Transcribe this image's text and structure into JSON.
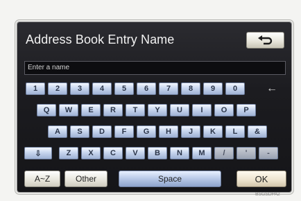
{
  "header": {
    "title": "Address Book Entry Name"
  },
  "input": {
    "value": "Enter a name"
  },
  "keyboard": {
    "row1": [
      "1",
      "2",
      "3",
      "4",
      "5",
      "6",
      "7",
      "8",
      "9",
      "0"
    ],
    "row2": [
      "Q",
      "W",
      "E",
      "R",
      "T",
      "Y",
      "U",
      "I",
      "O",
      "P"
    ],
    "row3": [
      "A",
      "S",
      "D",
      "F",
      "G",
      "H",
      "J",
      "K",
      "L",
      "&"
    ],
    "row4": [
      "Z",
      "X",
      "C",
      "V",
      "B",
      "N",
      "M",
      "/",
      "'",
      "-"
    ],
    "backspace_glyph": "←",
    "shift_glyph": "⇩"
  },
  "bottom": {
    "az_label": "A~Z",
    "other_label": "Other",
    "space_label": "Space",
    "ok_label": "OK"
  },
  "image_code": "BSGSDPA2"
}
